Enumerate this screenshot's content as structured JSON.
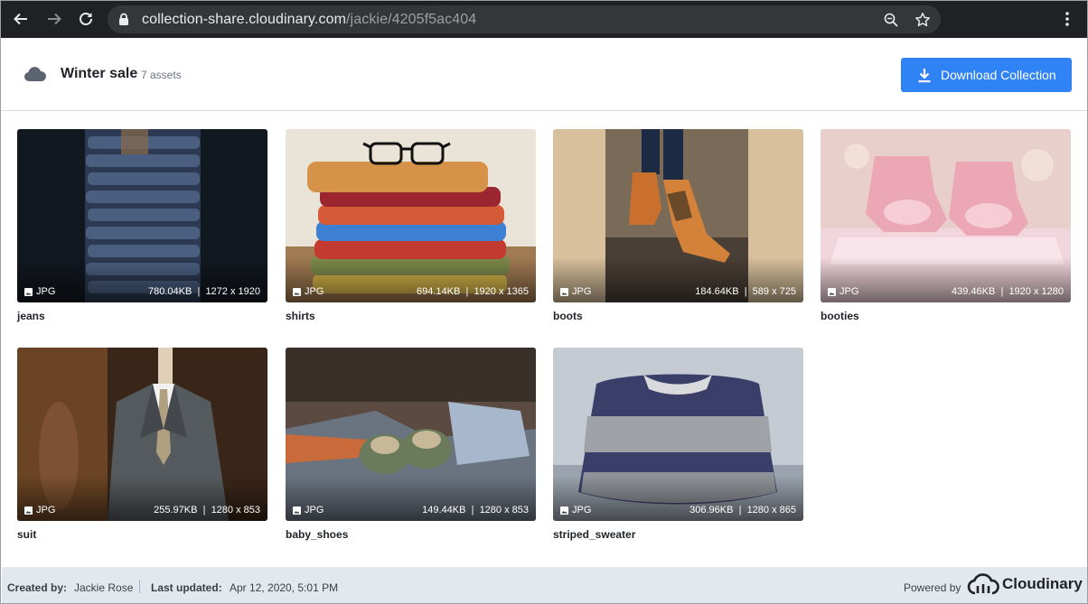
{
  "browser": {
    "url_host": "collection-share.cloudinary.com",
    "url_path": "/jackie/4205f5ac404"
  },
  "collection": {
    "title": "Winter sale",
    "count": "7 assets",
    "download_label": "Download Collection",
    "accent": "#3083f4"
  },
  "assets": [
    {
      "name": "jeans",
      "format": "JPG",
      "size": "780.04KB",
      "dims": "1272 x 1920"
    },
    {
      "name": "shirts",
      "format": "JPG",
      "size": "694.14KB",
      "dims": "1920 x 1365"
    },
    {
      "name": "boots",
      "format": "JPG",
      "size": "184.64KB",
      "dims": "589 x 725"
    },
    {
      "name": "booties",
      "format": "JPG",
      "size": "439.46KB",
      "dims": "1920 x 1280"
    },
    {
      "name": "suit",
      "format": "JPG",
      "size": "255.97KB",
      "dims": "1280 x 853"
    },
    {
      "name": "baby_shoes",
      "format": "JPG",
      "size": "149.44KB",
      "dims": "1280 x 853"
    },
    {
      "name": "striped_sweater",
      "format": "JPG",
      "size": "306.96KB",
      "dims": "1280 x 865"
    }
  ],
  "footer": {
    "created_by_label": "Created by:",
    "created_by": "Jackie Rose",
    "updated_label": "Last updated:",
    "updated": "Apr 12, 2020, 5:01 PM",
    "powered_by": "Powered by",
    "brand": "Cloudinary"
  }
}
